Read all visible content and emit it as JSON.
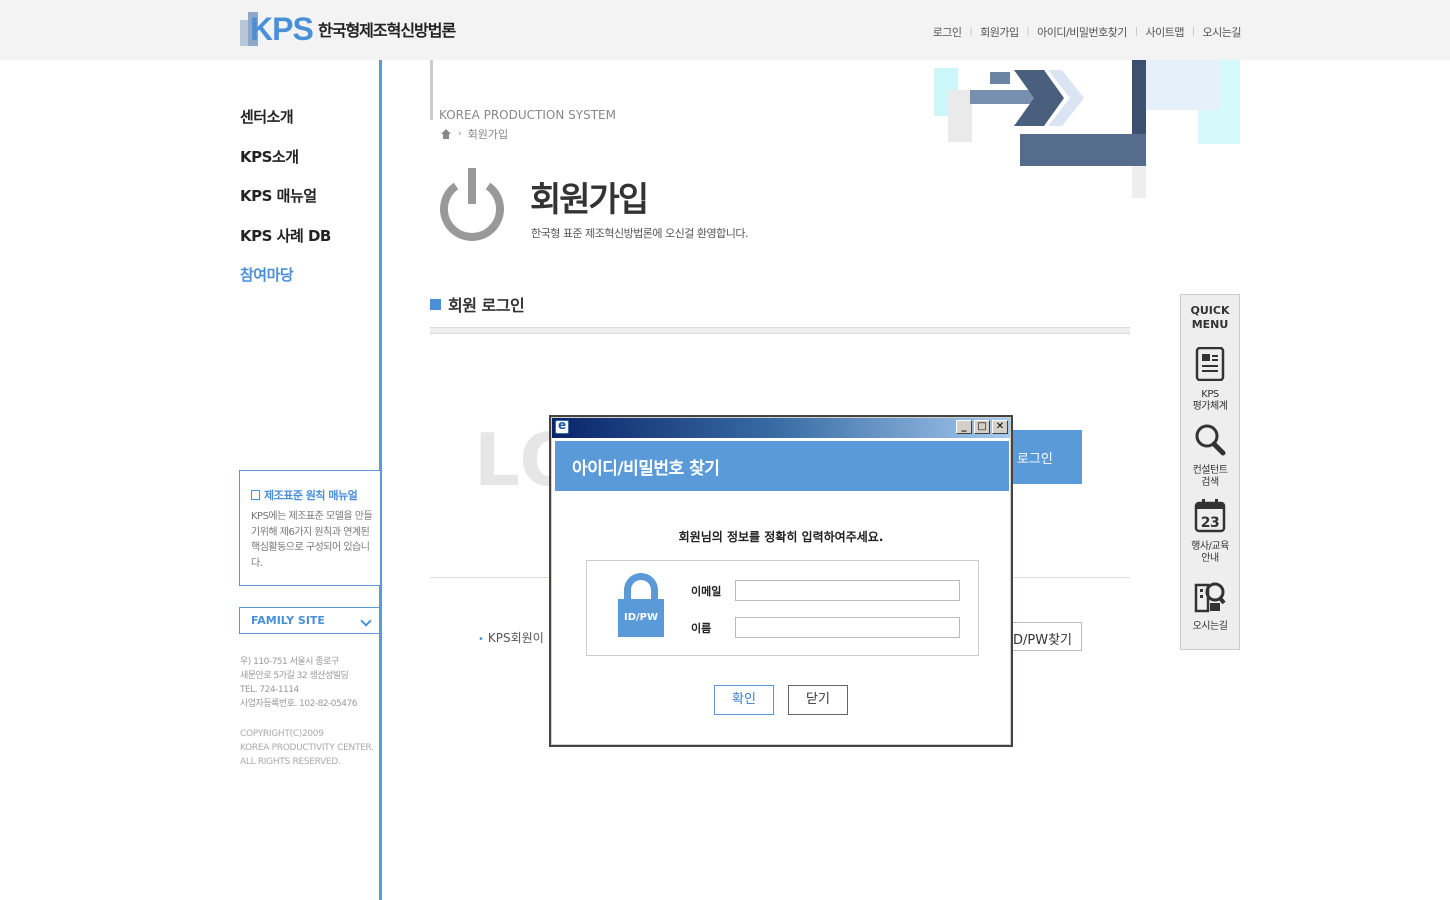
{
  "header": {
    "logo_text": "KPS",
    "site_name": "한국형제조혁신방법론",
    "nav": [
      "로그인",
      "회원가입",
      "아이디/비밀번호찾기",
      "사이트맵",
      "오시는길"
    ]
  },
  "sidebar": {
    "items": [
      {
        "label": "센터소개",
        "active": false
      },
      {
        "label": "KPS소개",
        "active": false
      },
      {
        "label": "KPS 매뉴얼",
        "active": false
      },
      {
        "label": "KPS 사례 DB",
        "active": false
      },
      {
        "label": "참여마당",
        "active": true
      }
    ],
    "manual": {
      "title": "제조표준 원칙 매뉴얼",
      "desc": "KPS에는 제조표준 모델을 만들기위해 제6가지 원칙과 연계된 핵심활동으로 구성되어 있습니다."
    },
    "family_site": "FAMILY SITE",
    "address": [
      "우) 110-751 서울시 종로구",
      "새문안로 5가길 32 생산성빌딩",
      "TEL. 724-1114",
      "사업자등록번호. 102-82-05476"
    ],
    "copyright": [
      "COPYRIGHT(C)2009",
      "KOREA PRODUCTIVITY CENTER.",
      "ALL RIGHTS RESERVED."
    ]
  },
  "main": {
    "kps_en": "KOREA PRODUCTION SYSTEM",
    "breadcrumb": "회원가입",
    "title": "회원가입",
    "subtitle": "한국형 표준 제조혁신방법론에 오신걸 환영합니다.",
    "section_title": "회원 로그인",
    "login_bg_text": "LO",
    "login_button": "로그인",
    "member_note": "KPS회원이",
    "idpw_button": "D/PW찾기"
  },
  "quick_menu": {
    "title": [
      "QUICK",
      "MENU"
    ],
    "items": [
      {
        "label": [
          "KPS",
          "평가체계"
        ],
        "icon": "document-icon"
      },
      {
        "label": [
          "컨설턴트",
          "검색"
        ],
        "icon": "magnifier-icon"
      },
      {
        "label": [
          "행사/교육",
          "안내"
        ],
        "icon": "calendar-icon",
        "calendar_day": "23"
      },
      {
        "label": [
          "오시는길"
        ],
        "icon": "building-map-icon"
      }
    ]
  },
  "popup": {
    "window_buttons": [
      "_",
      "□",
      "✕"
    ],
    "header": "아이디/비밀번호 찾기",
    "message": "회원님의 정보를 정확히 입력하여주세요.",
    "lock_text": "ID/PW",
    "fields": [
      {
        "label": "이메일",
        "value": "",
        "placeholder": ""
      },
      {
        "label": "이름",
        "value": "",
        "placeholder": ""
      }
    ],
    "confirm": "확인",
    "close": "닫기"
  },
  "colors": {
    "accent": "#5b9ad8",
    "accent_text": "#4a90d9"
  }
}
